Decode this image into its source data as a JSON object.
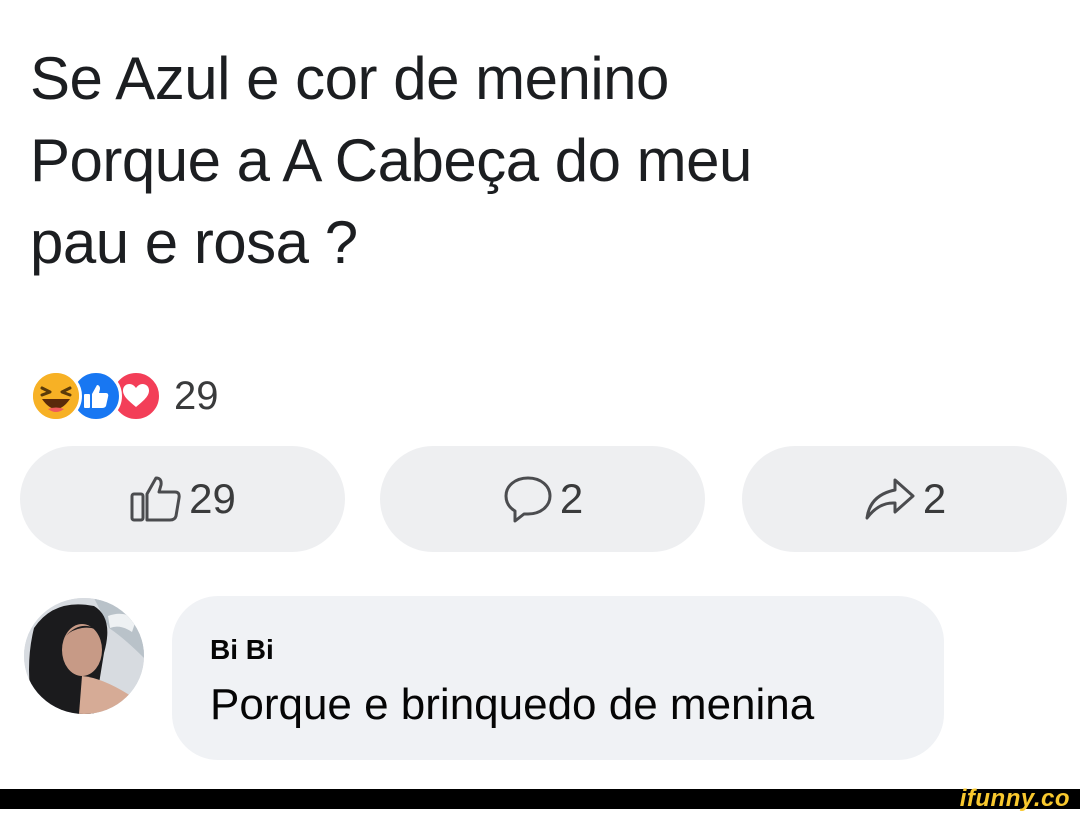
{
  "post": {
    "text": "Se Azul e cor de menino\nPorque a A Cabeça do meu\npau e rosa  ?"
  },
  "reactions": {
    "icons": [
      "haha-icon",
      "like-icon",
      "love-icon"
    ],
    "count": "29"
  },
  "actions": {
    "like_count": "29",
    "comment_count": "2",
    "share_count": "2"
  },
  "comment": {
    "author": "Bi Bi",
    "text": "Porque e brinquedo de menina"
  },
  "watermark": "ifunny.co",
  "colors": {
    "like_blue": "#1877f2",
    "love_red": "#f33e58",
    "haha_yellow": "#f7b125",
    "button_bg": "#eeeff1",
    "bubble_bg": "#f0f2f5",
    "watermark_yellow": "#f8c82e"
  }
}
